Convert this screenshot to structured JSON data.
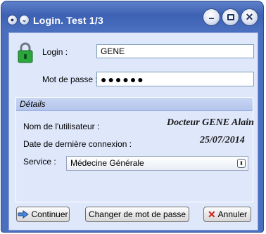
{
  "window": {
    "title": "Login. Test 1/3",
    "system_icons": [
      "menu-icon",
      "chevron-down-icon"
    ],
    "controls": {
      "minimize": "minimize-icon",
      "maximize": "maximize-icon",
      "close": "close-icon"
    }
  },
  "login": {
    "lock_icon": "lock-icon",
    "login_label": "Login :",
    "login_value": "GENE",
    "password_label": "Mot de passe :",
    "password_value": "●●●●●●"
  },
  "details": {
    "header": "Détails",
    "user_name_label": "Nom de l'utilisateur :",
    "user_name_value": "Docteur GENE Alain",
    "last_login_label": "Date de dernière connexion :",
    "last_login_value": "25/07/2014",
    "service_label": "Service :",
    "service_value": "Médecine Générale"
  },
  "buttons": {
    "continue": "Continuer",
    "change_password": "Changer de mot de passe",
    "cancel": "Annuler"
  },
  "colors": {
    "accent": "#3d61b3",
    "client_bg": "#dfe7fb",
    "cancel_icon": "#d11c1c"
  }
}
